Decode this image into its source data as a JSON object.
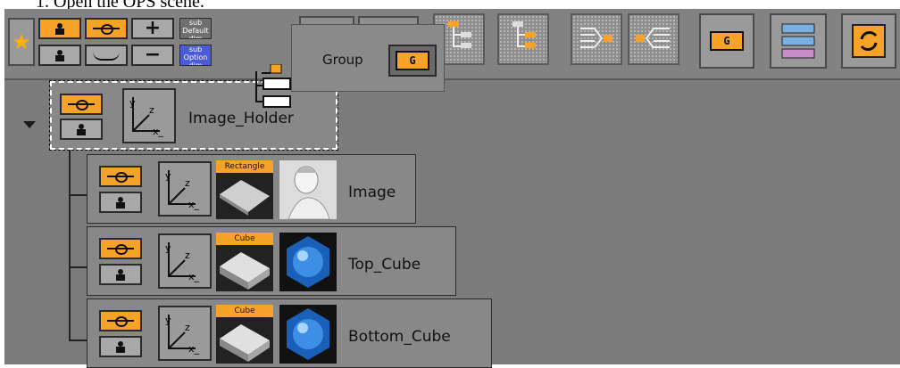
{
  "document": {
    "step_text": "1.  Open the OPS scene."
  },
  "toolbar": {
    "subdef_top": "sub Default dim",
    "subdef_bottom": "sub Option dim",
    "plus": "+",
    "minus": "−",
    "star": "★"
  },
  "group_popup": {
    "label": "Group",
    "icon_text": "G"
  },
  "tree": {
    "root": {
      "name": "Image_Holder"
    },
    "children": [
      {
        "name": "Image",
        "geometry_label": "Rectangle"
      },
      {
        "name": "Top_Cube",
        "geometry_label": "Cube"
      },
      {
        "name": "Bottom_Cube",
        "geometry_label": "Cube"
      }
    ]
  },
  "colors": {
    "accent_orange": "#f7a229",
    "selection_blue": "#4a5ad8",
    "panel_bg": "#7b7b7b"
  }
}
